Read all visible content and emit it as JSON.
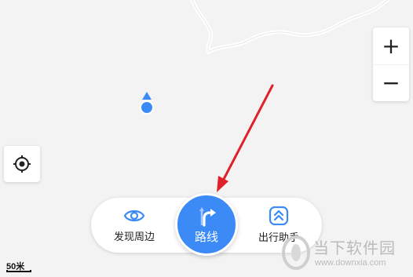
{
  "map": {
    "road_color": "#ffffff",
    "location_marker_color": "#3b8af6",
    "annotation_arrow_color": "#e0202a"
  },
  "zoom": {
    "zoom_in_label": "+",
    "zoom_out_label": "−"
  },
  "locate": {
    "icon": "locate-crosshair-icon"
  },
  "bottom_bar": {
    "discover_label": "发现周边",
    "discover_icon": "eye-icon",
    "assistant_label": "出行助手",
    "assistant_icon": "double-chevron-up-icon",
    "route_label": "路线",
    "route_icon": "turn-right-arrow-icon",
    "accent_color": "#3b8af6"
  },
  "scale": {
    "label": "50米"
  },
  "watermark": {
    "text": "当下软件园",
    "url": "www.downxia.com"
  }
}
